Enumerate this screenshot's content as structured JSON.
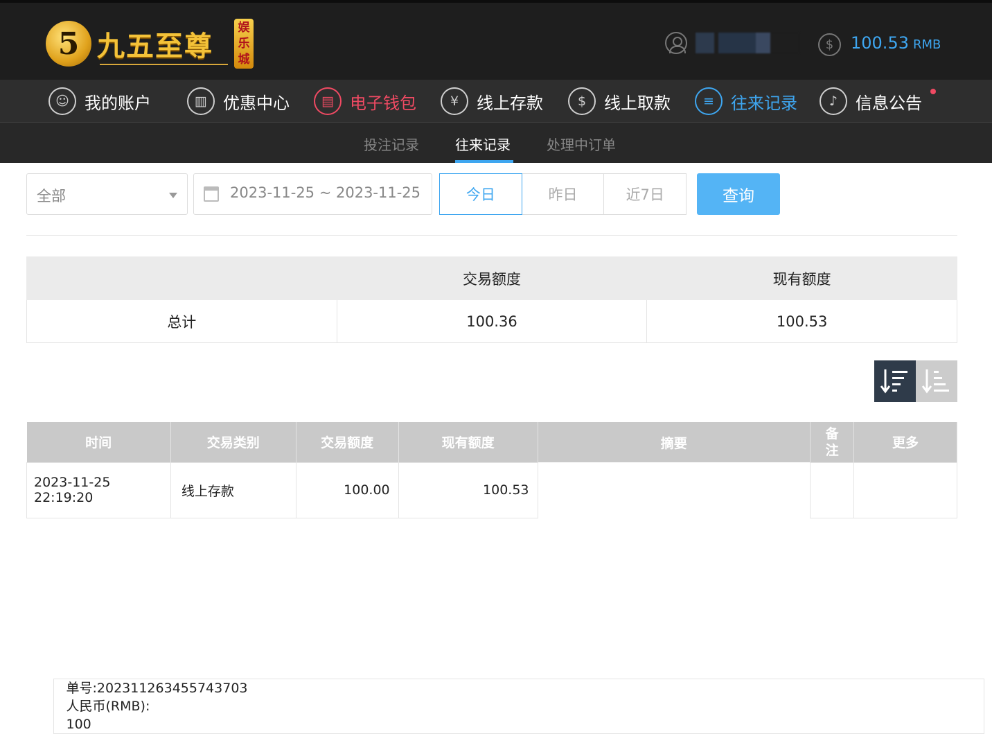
{
  "header": {
    "logo_mark": "5",
    "logo_text": "九五至尊",
    "logo_tag": "娱乐城",
    "balance_value": "100.53",
    "balance_unit": "RMB",
    "coin_symbol": "$"
  },
  "nav": {
    "items": [
      {
        "label": "我的账户",
        "icon": "user-icon"
      },
      {
        "label": "优惠中心",
        "icon": "gift-icon"
      },
      {
        "label": "电子钱包",
        "icon": "wallet-icon"
      },
      {
        "label": "线上存款",
        "icon": "deposit-icon"
      },
      {
        "label": "线上取款",
        "icon": "withdraw-icon"
      },
      {
        "label": "往来记录",
        "icon": "records-icon"
      },
      {
        "label": "信息公告",
        "icon": "bell-icon"
      }
    ]
  },
  "subnav": {
    "items": [
      "投注记录",
      "往来记录",
      "处理中订单"
    ]
  },
  "filter": {
    "type_value": "全部",
    "date_range": "2023-11-25 ~ 2023-11-25",
    "quick": [
      "今日",
      "昨日",
      "近7日"
    ],
    "query_label": "查询"
  },
  "summary": {
    "headers": [
      "",
      "交易额度",
      "现有额度"
    ],
    "row": [
      "总计",
      "100.36",
      "100.53"
    ]
  },
  "sort": {
    "desc_icon": "sort-descending-icon",
    "asc_icon": "sort-ascending-icon"
  },
  "table": {
    "columns": [
      "时间",
      "交易类别",
      "交易额度",
      "现有额度",
      "摘要",
      "备注",
      "更多"
    ],
    "rows": [
      {
        "time": "2023-11-25 22:19:20",
        "type": "线上存款",
        "amount": "100.00",
        "balance": "100.53",
        "summary_line1": "单号:202311263455743703",
        "summary_line2": "人民币(RMB):",
        "summary_line3": "100",
        "note": "",
        "more": ""
      }
    ]
  },
  "colors": {
    "accent": "#3ea6f0",
    "alert": "#f04a63",
    "topbar": "#1e1e1e",
    "gold": "#f4c238"
  }
}
